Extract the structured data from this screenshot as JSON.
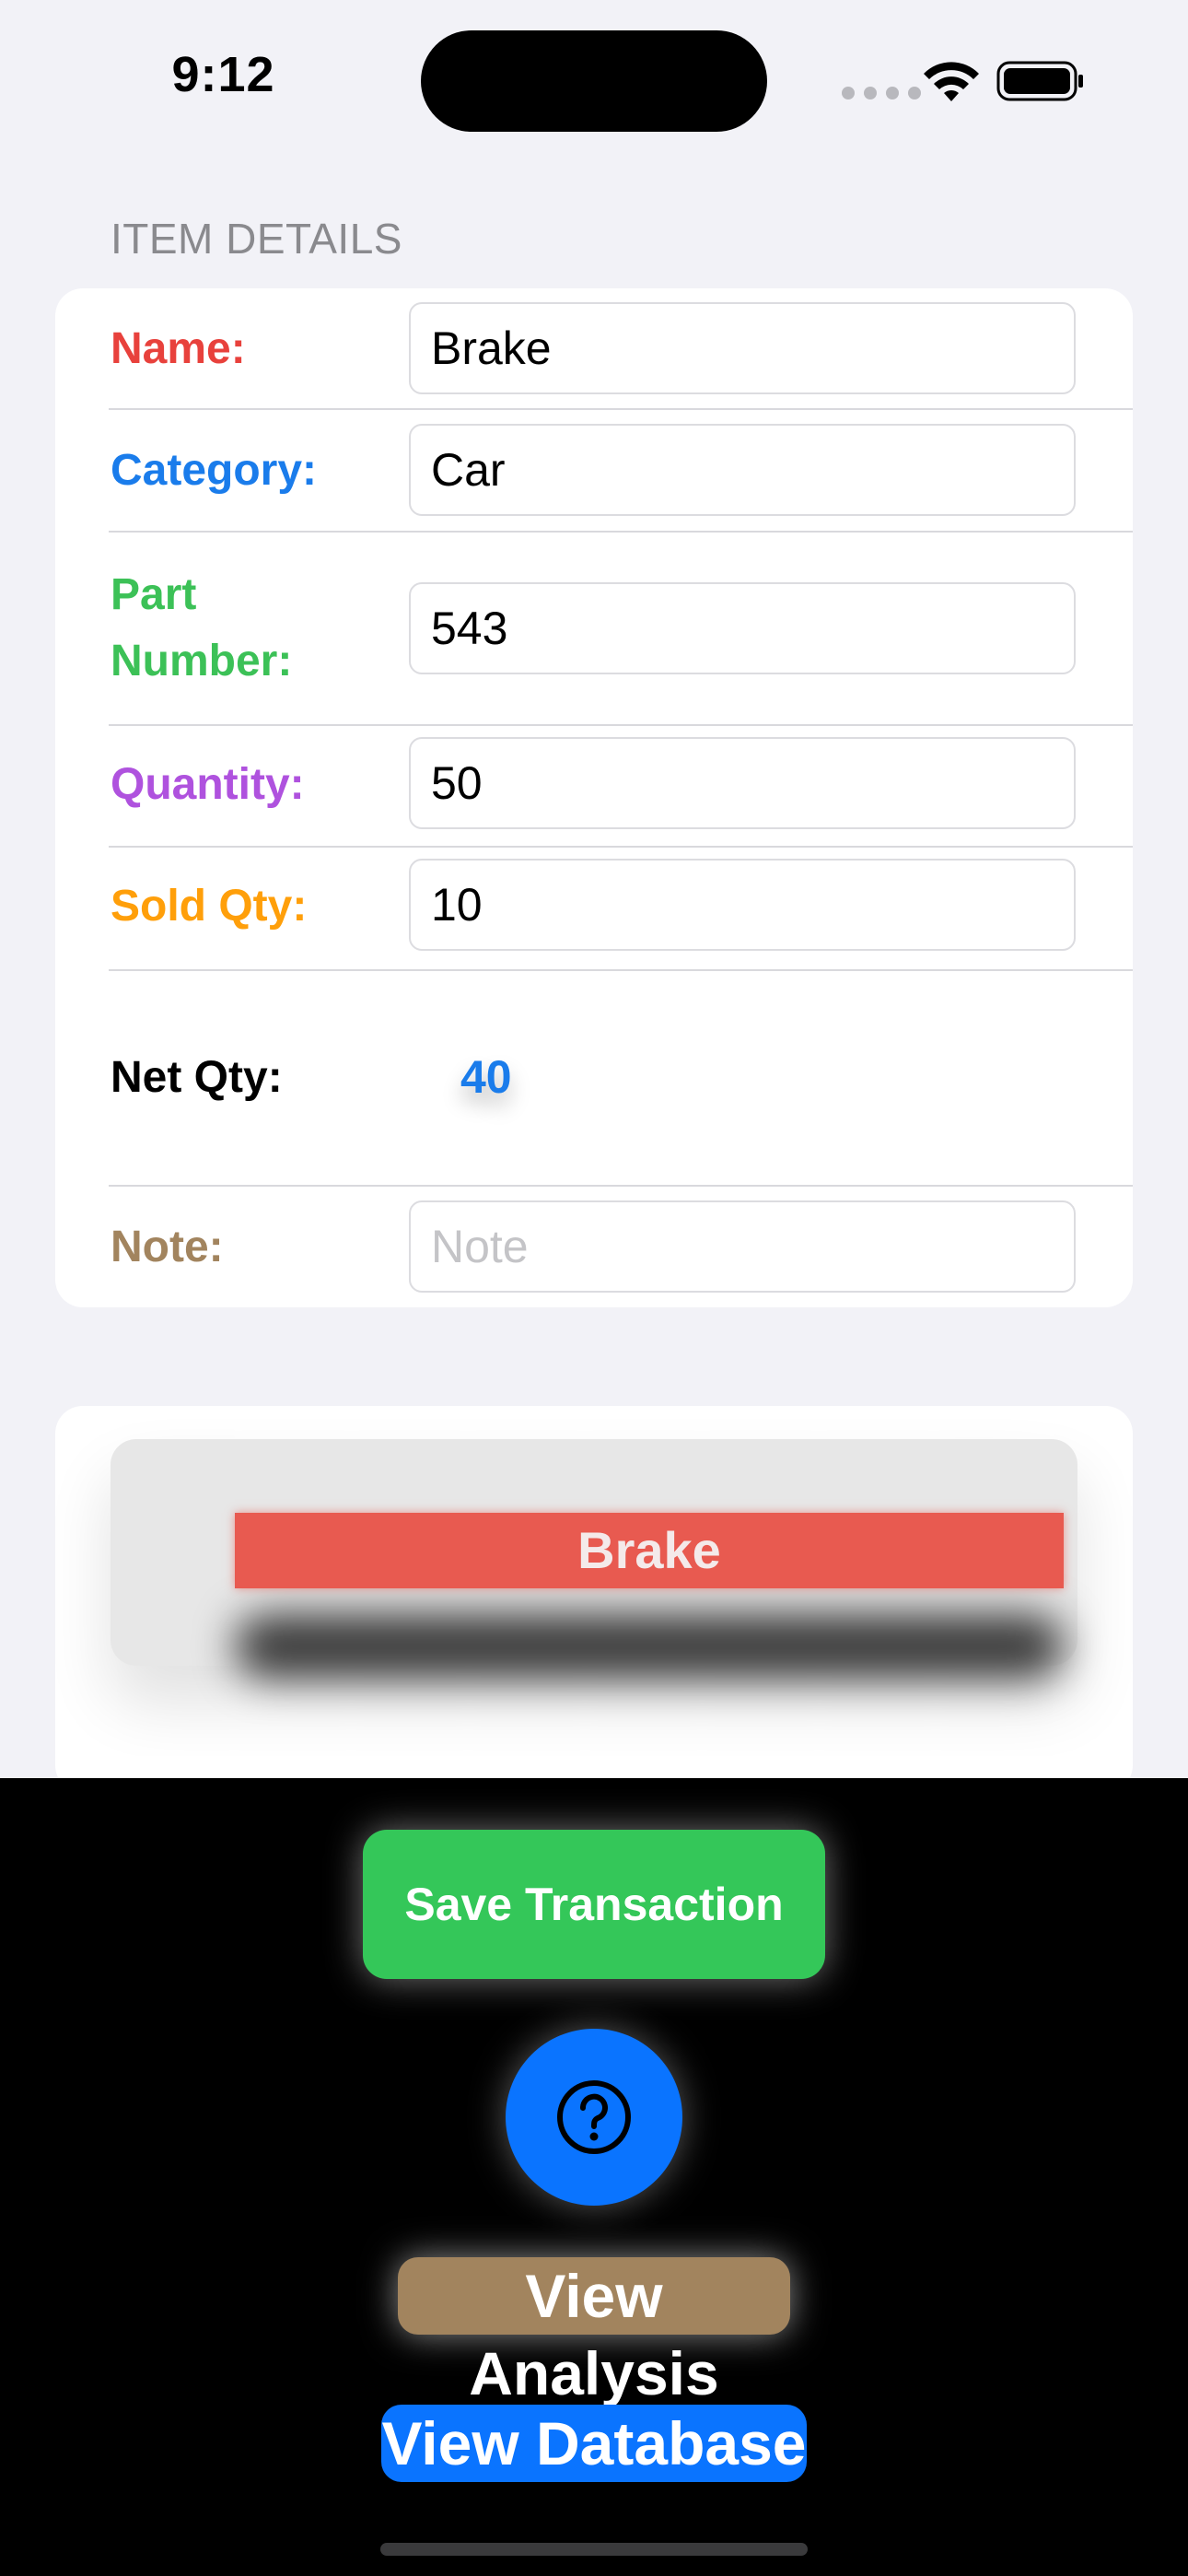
{
  "status_bar": {
    "time": "9:12",
    "icons": [
      "cellular-signal-icon",
      "wifi-icon",
      "battery-icon"
    ]
  },
  "section": {
    "header": "ITEM DETAILS"
  },
  "form": {
    "name": {
      "label": "Name:",
      "value": "Brake",
      "color": "#e8413c"
    },
    "category": {
      "label": "Category:",
      "value": "Car",
      "color": "#1a7ceb"
    },
    "part_number": {
      "label_line1": "Part",
      "label_line2": "Number:",
      "value": "543",
      "color": "#3cc157"
    },
    "quantity": {
      "label": "Quantity:",
      "value": "50",
      "color": "#af52de"
    },
    "sold_qty": {
      "label": "Sold Qty:",
      "value": "10",
      "color": "#ff9f0a"
    },
    "net_qty": {
      "label": "Net Qty:",
      "value": "40",
      "color": "#1a7ceb"
    },
    "note": {
      "label": "Note:",
      "value": "",
      "placeholder": "Note",
      "color": "#a2845e"
    }
  },
  "preview": {
    "tag_text": "Brake"
  },
  "actions": {
    "save_label": "Save Transaction",
    "help_icon": "question-mark-circle-icon",
    "analysis_label": "View Analysis",
    "database_label": "View Database"
  },
  "colors": {
    "background": "#f2f2f7",
    "save_green": "#34c759",
    "help_blue": "#0a74ff",
    "analysis_brown": "#a2845e",
    "tag_red": "#e85a50"
  }
}
